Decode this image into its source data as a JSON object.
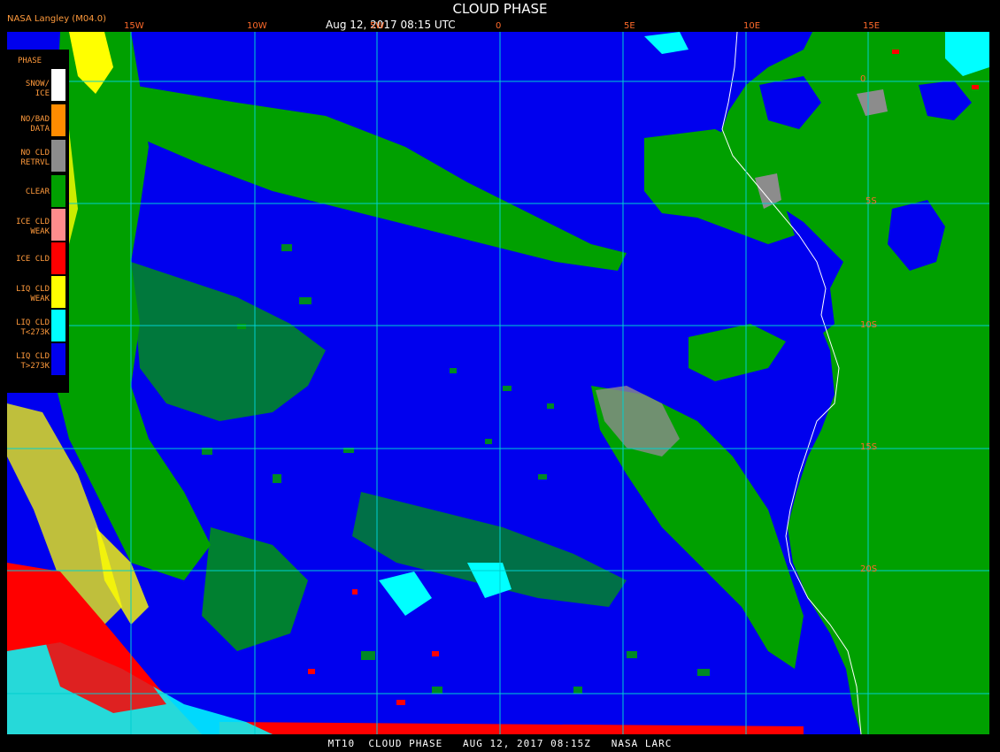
{
  "header": {
    "agency": "NASA Langley (M04.0)",
    "title": "CLOUD PHASE",
    "subtitle": "Aug 12, 2017 08:15 UTC"
  },
  "map": {
    "lon_labels": [
      "15W",
      "10W",
      "5W",
      "0",
      "5E",
      "10E",
      "15E"
    ],
    "lat_labels": [
      "0",
      "5S",
      "10S",
      "15S",
      "20S"
    ]
  },
  "legend": {
    "title": "PHASE",
    "items": [
      {
        "label": "SNOW/ ICE",
        "color": "#ffffff"
      },
      {
        "label": "NO/BAD DATA",
        "color": "#ff8c00"
      },
      {
        "label": "NO CLD RETRVL",
        "color": "#8c8c8c"
      },
      {
        "label": "CLEAR",
        "color": "#00a000"
      },
      {
        "label": "ICE CLD WEAK",
        "color": "#ff8c8c"
      },
      {
        "label": "ICE CLD",
        "color": "#ff0000"
      },
      {
        "label": "LIQ CLD WEAK",
        "color": "#ffff00"
      },
      {
        "label": "LIQ CLD T<273K",
        "color": "#00ffff"
      },
      {
        "label": "LIQ CLD T>273K",
        "color": "#0000ee"
      }
    ]
  },
  "footer": {
    "text": "MT10  CLOUD PHASE   AUG 12, 2017 08:15Z   NASA LARC"
  }
}
